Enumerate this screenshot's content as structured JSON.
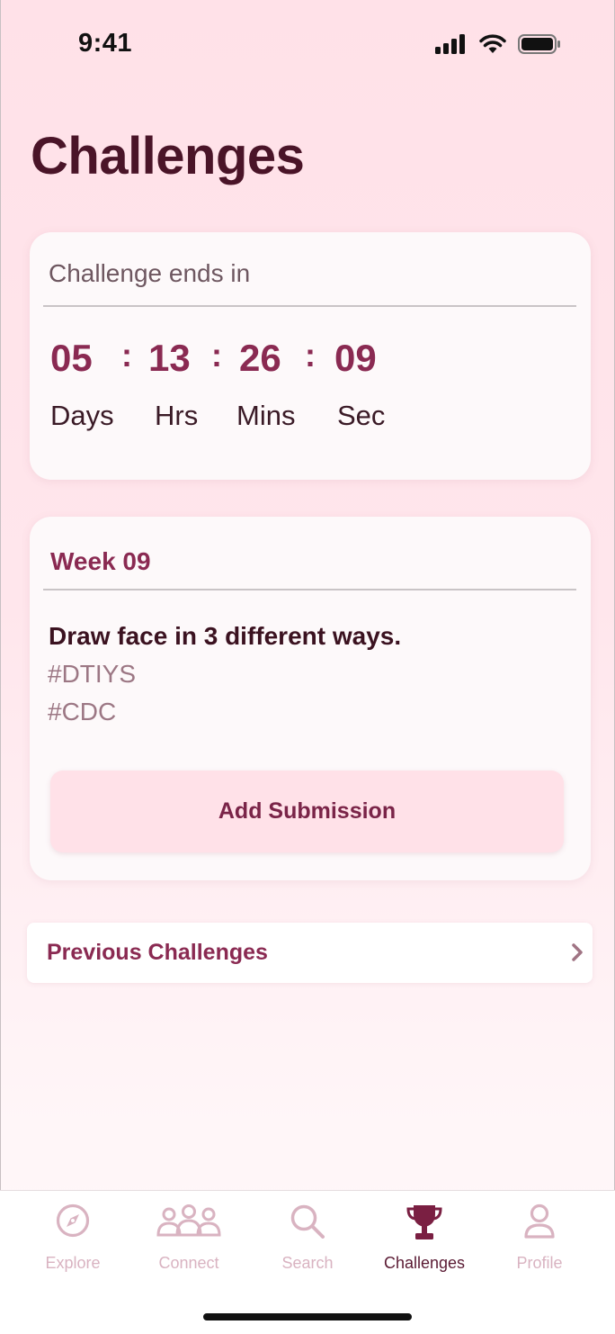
{
  "status_bar": {
    "time": "9:41"
  },
  "page": {
    "title": "Challenges"
  },
  "timer_card": {
    "label": "Challenge ends in",
    "days": "05",
    "hours": "13",
    "mins": "26",
    "secs": "09",
    "separator": ":",
    "units": {
      "days": "Days",
      "hours": "Hrs",
      "mins": "Mins",
      "secs": "Sec"
    }
  },
  "week_card": {
    "title": "Week 09",
    "prompt": "Draw face in 3 different ways.",
    "tags": [
      "#DTIYS",
      "#CDC"
    ],
    "button_label": "Add Submission"
  },
  "previous": {
    "label": "Previous Challenges"
  },
  "tabbar": {
    "items": [
      {
        "label": "Explore",
        "icon": "compass-icon"
      },
      {
        "label": "Connect",
        "icon": "people-group-icon"
      },
      {
        "label": "Search",
        "icon": "search-icon"
      },
      {
        "label": "Challenges",
        "icon": "trophy-icon"
      },
      {
        "label": "Profile",
        "icon": "person-icon"
      }
    ],
    "active": "Challenges"
  },
  "colors": {
    "accent": "#8a2a52",
    "title": "#4a1428",
    "tab_inactive": "#d9b3c1",
    "button_bg": "#ffe1e8"
  }
}
